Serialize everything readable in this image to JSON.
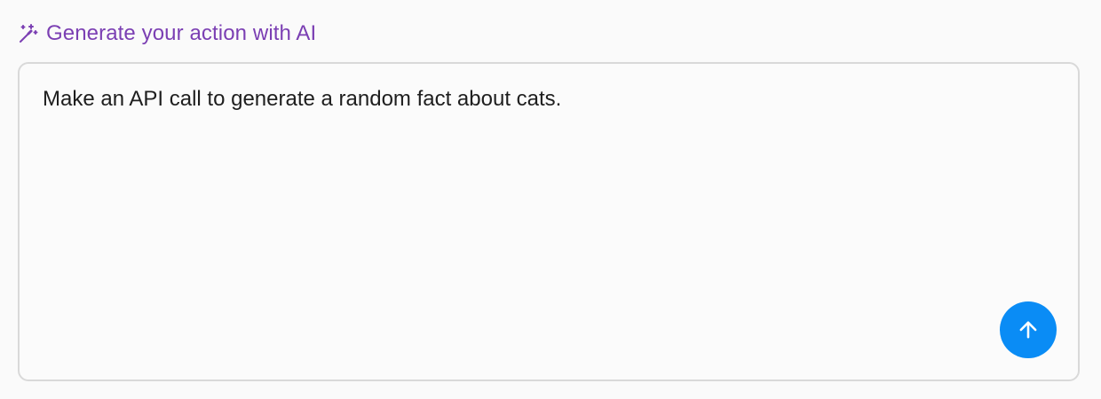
{
  "header": {
    "icon": "magic-wand-icon",
    "title": "Generate your action with AI",
    "title_color": "#7b3fb3"
  },
  "prompt": {
    "value": "Make an API call to generate a random fact about cats."
  },
  "send_button": {
    "icon": "arrow-up-icon",
    "color": "#0a8cf5"
  }
}
